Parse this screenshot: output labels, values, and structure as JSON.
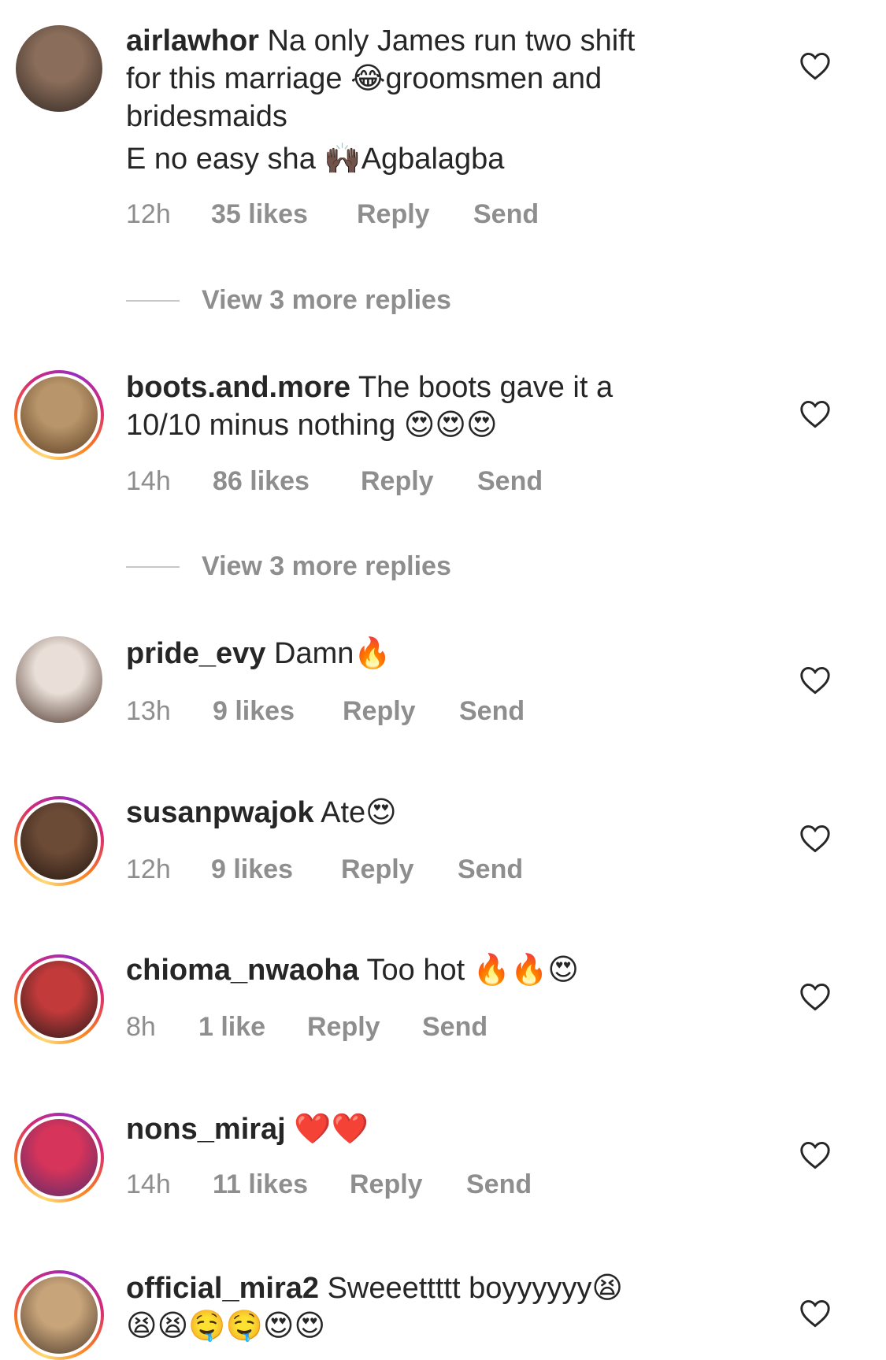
{
  "comments": [
    {
      "username": "airlawhor",
      "lines": [
        "Na only James run two shift",
        "for this marriage 😂groomsmen and",
        "bridesmaids",
        "E no easy sha 🙌🏿Agbalagba"
      ],
      "time": "12h",
      "likes": "35 likes",
      "reply": "Reply",
      "send": "Send",
      "view_replies": "View 3 more replies",
      "avatar_colors": [
        "#8a6d5a",
        "#2f2621"
      ],
      "ring": false
    },
    {
      "username": "boots.and.more",
      "lines": [
        "The boots gave it a",
        "10/10 minus nothing 😍😍😍"
      ],
      "time": "14h",
      "likes": "86 likes",
      "reply": "Reply",
      "send": "Send",
      "view_replies": "View 3 more replies",
      "avatar_colors": [
        "#b8956a",
        "#5b3d22"
      ],
      "ring": true
    },
    {
      "username": "pride_evy",
      "lines": [
        "Damn🔥"
      ],
      "time": "13h",
      "likes": "9 likes",
      "reply": "Reply",
      "send": "Send",
      "avatar_colors": [
        "#e9dfd8",
        "#4a3328"
      ],
      "ring": false
    },
    {
      "username": "susanpwajok",
      "lines": [
        "Ate😍"
      ],
      "time": "12h",
      "likes": "9 likes",
      "reply": "Reply",
      "send": "Send",
      "avatar_colors": [
        "#6b4a36",
        "#241710"
      ],
      "ring": true
    },
    {
      "username": "chioma_nwaoha",
      "lines": [
        "Too hot 🔥🔥😍"
      ],
      "time": "8h",
      "likes": "1 like",
      "reply": "Reply",
      "send": "Send",
      "avatar_colors": [
        "#c23a3a",
        "#2a1a1a"
      ],
      "ring": true
    },
    {
      "username": "nons_miraj",
      "lines": [
        "❤️❤️"
      ],
      "time": "14h",
      "likes": "11 likes",
      "reply": "Reply",
      "send": "Send",
      "avatar_colors": [
        "#d6345a",
        "#5a2a6a"
      ],
      "ring": true
    },
    {
      "username": "official_mira2",
      "lines": [
        "Sweeettttt boyyyyyy😫",
        "😫😫🤤🤤😍😍"
      ],
      "avatar_colors": [
        "#c8a47a",
        "#4c3a2c"
      ],
      "ring": true
    }
  ],
  "colors": {
    "text": "#262626",
    "secondary": "#8e8e8e",
    "heart_stroke": "#262626"
  },
  "icons": {
    "like": "heart-outline-icon"
  }
}
